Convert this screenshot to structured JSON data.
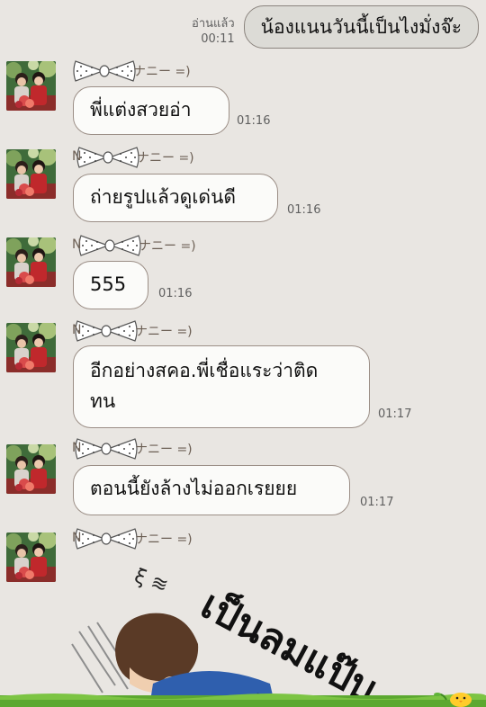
{
  "sent": {
    "read_label": "อ่านแล้ว",
    "time": "00:11",
    "text": "น้องแนนวันนี้เป็นไงมั่งจ๊ะ"
  },
  "sender": {
    "name_prefix": "N",
    "name_suffix": "ナニー =)"
  },
  "messages": [
    {
      "text": "พี่แต่งสวยอ่า",
      "time": "01:16"
    },
    {
      "text": "ถ่ายรูปแล้วดูเด่นดี",
      "time": "01:16"
    },
    {
      "text": "555",
      "time": "01:16"
    },
    {
      "text_line1": "อีกอย่างสคอ.พี่เชื่อแระว่าติด",
      "text_line2": "ทน",
      "time": "01:17"
    },
    {
      "text": "ตอนนี้ยังล้างไม่ออกเรยยย",
      "time": "01:17"
    }
  ],
  "sticker": {
    "text": "เป็นลมแป๊บ",
    "sound": "ξ ≋"
  },
  "colors": {
    "background": "#e9e6e2",
    "bubble_received": "#fbfbf9",
    "bubble_sent": "#dcdbd6",
    "bubble_border": "#9b8e86",
    "character_shirt": "#2f5fae"
  }
}
